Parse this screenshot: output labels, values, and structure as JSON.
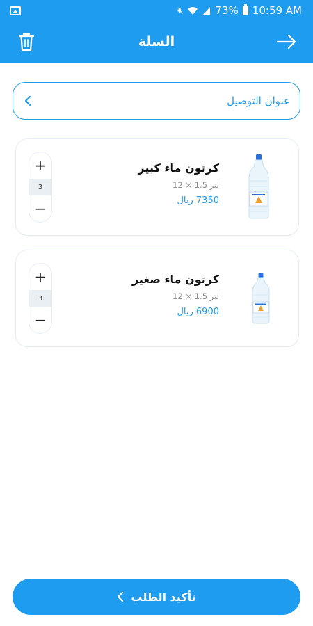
{
  "status_bar": {
    "battery": "73%",
    "time": "10:59 AM"
  },
  "header": {
    "title": "السلة"
  },
  "address": {
    "label": "عنوان التوصيل"
  },
  "cart": {
    "items": [
      {
        "name": "كرتون ماء كبير",
        "size": "12 × 1.5 لتر",
        "price": "7350 ريال",
        "quantity": "3"
      },
      {
        "name": "كرتون ماء صغير",
        "size": "12 × 1.5 لتر",
        "price": "6900 ريال",
        "quantity": "3"
      }
    ],
    "increment_symbol": "+",
    "decrement_symbol": "−"
  },
  "confirm": {
    "label": "تأكيد الطلب"
  },
  "colors": {
    "primary": "#1e9cf0",
    "border": "#e6eef5",
    "muted_text": "#8a8a8a"
  },
  "icons": [
    "gallery-icon",
    "mute-icon",
    "wifi-icon",
    "signal-icon",
    "battery-icon",
    "trash-icon",
    "arrow-right-icon",
    "chevron-left-icon",
    "plus-icon",
    "minus-icon",
    "water-bottle-icon"
  ]
}
